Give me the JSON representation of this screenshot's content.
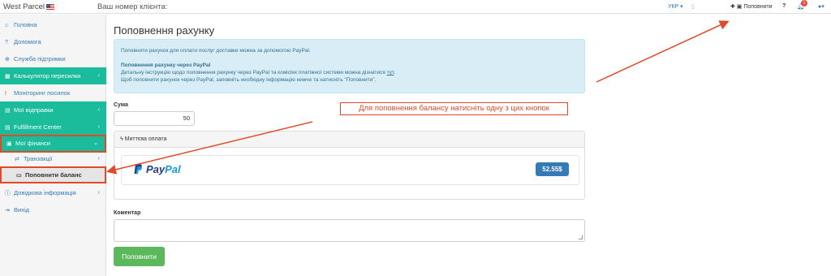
{
  "topbar": {
    "brand": "West Parcel",
    "client_label": "Ваш номер клієнта:",
    "language": "УКР ▾",
    "topup_link": "Поповнити",
    "help": "?",
    "notifications_count": "1",
    "user_caret": "▾"
  },
  "sidebar": {
    "items": [
      {
        "icon": "home-icon",
        "glyph": "⌂",
        "label": "Головна"
      },
      {
        "icon": "question-icon",
        "glyph": "?",
        "label": "Допомога"
      },
      {
        "icon": "lifebuoy-icon",
        "glyph": "⊕",
        "label": "Служба підтримки"
      },
      {
        "icon": "calculator-icon",
        "glyph": "▦",
        "label": "Калькулятор пересилки",
        "chevron": "‹"
      },
      {
        "icon": "exclamation-icon",
        "glyph": "!",
        "label": "Моніторинг посилок"
      },
      {
        "icon": "box-icon",
        "glyph": "▤",
        "label": "Мої відправки",
        "chevron": "‹"
      },
      {
        "icon": "warehouse-icon",
        "glyph": "▤",
        "label": "Fulfillment Center",
        "chevron": "‹"
      },
      {
        "icon": "wallet-icon",
        "glyph": "▣",
        "label": "Мої фінанси",
        "chevron": "⌄"
      },
      {
        "icon": "transfer-icon",
        "glyph": "⇄",
        "label": "Транзакції",
        "chevron": "‹"
      },
      {
        "icon": "card-icon",
        "glyph": "▭",
        "label": "Поповнити баланс"
      },
      {
        "icon": "info-icon",
        "glyph": "ⓘ",
        "label": "Довідкова інформація",
        "chevron": "‹"
      },
      {
        "icon": "logout-icon",
        "glyph": "⇥",
        "label": "Вихід"
      }
    ]
  },
  "main": {
    "title": "Поповнення рахунку",
    "alert": {
      "intro": "Поповнити рахунок для оплати послуг доставки можна за допомогою PayPal.",
      "heading": "Поповнення рахунку через PayPal",
      "line1": "Детальну інструкцію щодо поповнення рахунку через PayPal та комісіях платіжної системи можна дізнатися",
      "line1_link": "тут",
      "line2": "Щоб поповнити рахунок через PayPal, заповніть необхідну інформацію нижче та натисніть \"Поповнити\"."
    },
    "amount_label": "Сума",
    "amount_value": "50",
    "instant_payment_label": "Миттєва оплата",
    "paypal": {
      "pay": "Pay",
      "pal": "Pal",
      "price": "52.55$"
    },
    "comment_label": "Коментар",
    "submit_label": "Поповнити"
  },
  "annotation": "Для поповнення балансу натисніть одну з цих кнопок",
  "colors": {
    "accent": "#1abc9c",
    "annotation": "#e04a2a",
    "primary": "#337ab7",
    "success": "#5cb85c"
  }
}
